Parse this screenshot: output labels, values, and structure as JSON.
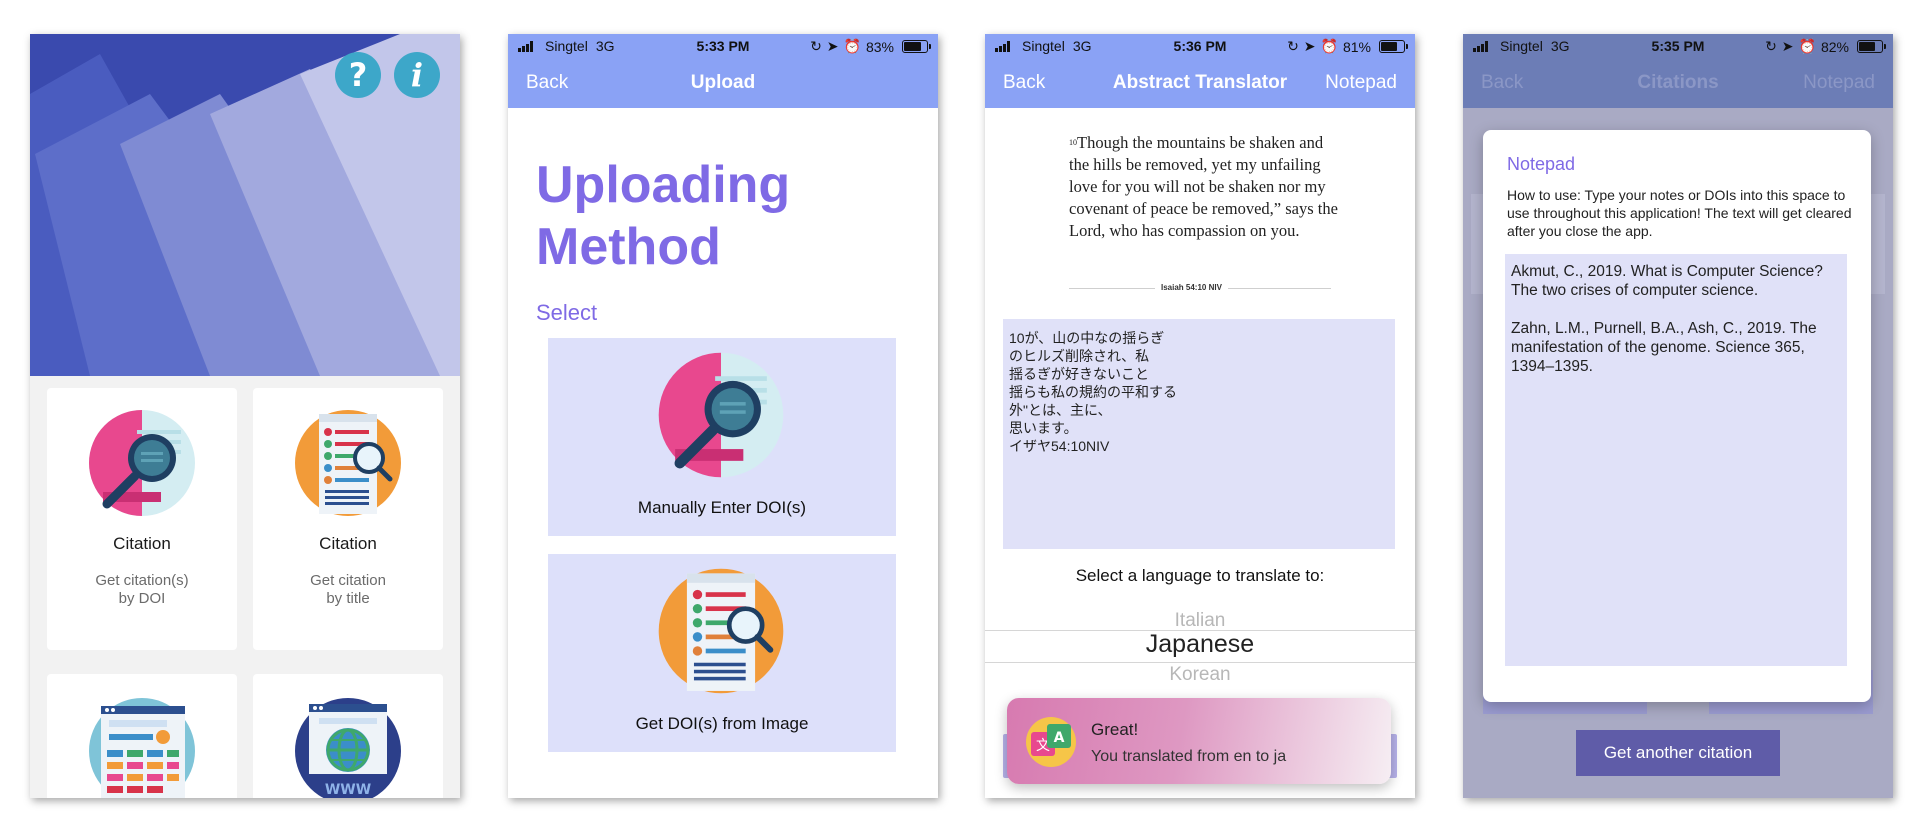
{
  "screens": {
    "home": {
      "buttons": {
        "help_glyph": "?",
        "info_glyph": "i"
      },
      "cards": [
        {
          "title": "Citation",
          "subtitle": "Get citation(s)\nby DOI",
          "icon": "magnifier-document-icon"
        },
        {
          "title": "Citation",
          "subtitle": "Get citation\nby title",
          "icon": "checklist-magnifier-icon"
        },
        {
          "title": "",
          "subtitle": "",
          "icon": "webpage-form-icon"
        },
        {
          "title": "",
          "subtitle": "",
          "icon": "www-globe-icon"
        }
      ]
    },
    "upload": {
      "status": {
        "carrier": "Singtel",
        "network": "3G",
        "time": "5:33 PM",
        "battery": "83%",
        "battery_level": 0.83
      },
      "nav": {
        "back": "Back",
        "title": "Upload"
      },
      "heading_line1": "Uploading",
      "heading_line2": "Method",
      "select_label": "Select",
      "options": [
        {
          "label": "Manually Enter DOI(s)",
          "icon": "magnifier-document-icon"
        },
        {
          "label": "Get DOI(s) from Image",
          "icon": "checklist-magnifier-icon"
        }
      ]
    },
    "translator": {
      "status": {
        "carrier": "Singtel",
        "network": "3G",
        "time": "5:36 PM",
        "battery": "81%",
        "battery_level": 0.81
      },
      "nav": {
        "back": "Back",
        "title": "Abstract Translator",
        "right": "Notepad"
      },
      "verse": {
        "number": "10",
        "text": "Though the mountains be shaken and the hills be removed, yet my unfailing love for you will not be shaken nor my covenant of peace be removed,” says the Lord, who has compassion on you.",
        "reference": "Isaiah 54:10 NIV"
      },
      "translated_text": "10が、山の中なの揺らぎ\nのヒルズ削除され、私\n揺るぎが好きないこと\n揺らも私の規約の平和する\n外\"とは、主に、\n思います。\nイザヤ54:10NIV",
      "language_prompt": "Select a language to translate to:",
      "picker": {
        "previous": "Italian",
        "selected": "Japanese",
        "next": "Korean"
      },
      "toast": {
        "title": "Great!",
        "message": "You translated from en to ja",
        "icon": "translate-icon"
      }
    },
    "citations": {
      "status": {
        "carrier": "Singtel",
        "network": "3G",
        "time": "5:35 PM",
        "battery": "82%",
        "battery_level": 0.82
      },
      "nav": {
        "back": "Back",
        "title": "Citations",
        "right": "Notepad"
      },
      "notepad": {
        "title": "Notepad",
        "help": "How to use: Type your notes or DOIs into this space to use throughout this application! The text will get cleared after you close the app.",
        "content": "Akmut, C., 2019. What is Computer Science? The two crises of computer science.\n\nZahn, L.M., Purnell, B.A., Ash, C., 2019. The manifestation of the genome. Science 365, 1394–1395."
      },
      "another_button": "Get another citation"
    }
  },
  "colors": {
    "accent_purple": "#7f6ae5",
    "nav_blue": "#8aa2f5",
    "option_bg": "#dde0fa",
    "text_box_bg": "#e0e1f8",
    "hero_blue": "#3f4fb4",
    "round_button_teal": "#3da7c9",
    "modal_button": "#5f5ca8"
  }
}
